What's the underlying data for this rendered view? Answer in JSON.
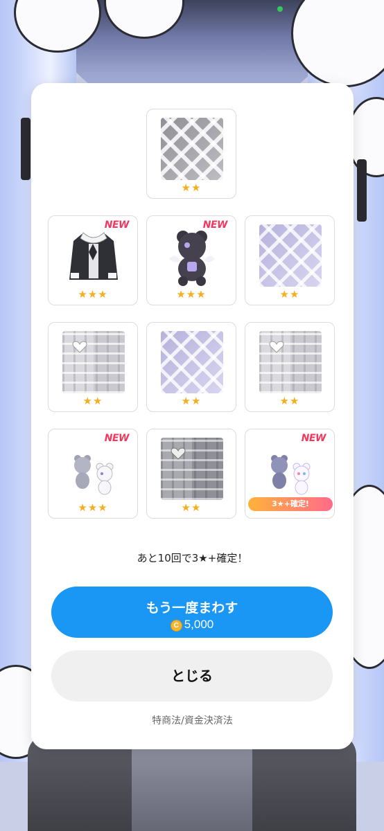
{
  "items": [
    {
      "stars": "★★",
      "is_new": false,
      "new_label": "",
      "art": "pattern-diamond-gray"
    },
    {
      "stars": "★★★",
      "is_new": true,
      "new_label": "NEW",
      "art": "black-jacket"
    },
    {
      "stars": "★★★",
      "is_new": true,
      "new_label": "NEW",
      "art": "dark-bear-plush"
    },
    {
      "stars": "★★",
      "is_new": false,
      "new_label": "",
      "art": "pattern-diamond-lavender"
    },
    {
      "stars": "★★",
      "is_new": false,
      "new_label": "",
      "art": "pattern-patchwork-light"
    },
    {
      "stars": "★★",
      "is_new": false,
      "new_label": "",
      "art": "pattern-diamond-lavender"
    },
    {
      "stars": "★★",
      "is_new": false,
      "new_label": "",
      "art": "pattern-patchwork-light"
    },
    {
      "stars": "★★★",
      "is_new": true,
      "new_label": "NEW",
      "art": "bear-pair-figures"
    },
    {
      "stars": "★★",
      "is_new": false,
      "new_label": "",
      "art": "pattern-patchwork-dark"
    },
    {
      "stars": "★★★",
      "is_new": true,
      "new_label": "NEW",
      "art": "bear-pair-figures"
    }
  ],
  "guarantee_badge": "3★+確定!",
  "hint_text": "あと10回で3★+確定！",
  "spin_again": {
    "label": "もう一度まわす",
    "cost": "5,000",
    "currency_icon": "coin-icon"
  },
  "close_label": "とじる",
  "legal_link": "特商法/資金決済法",
  "colors": {
    "primary": "#1a96f5",
    "star": "#f6ae1d",
    "new": "#f2385f"
  }
}
